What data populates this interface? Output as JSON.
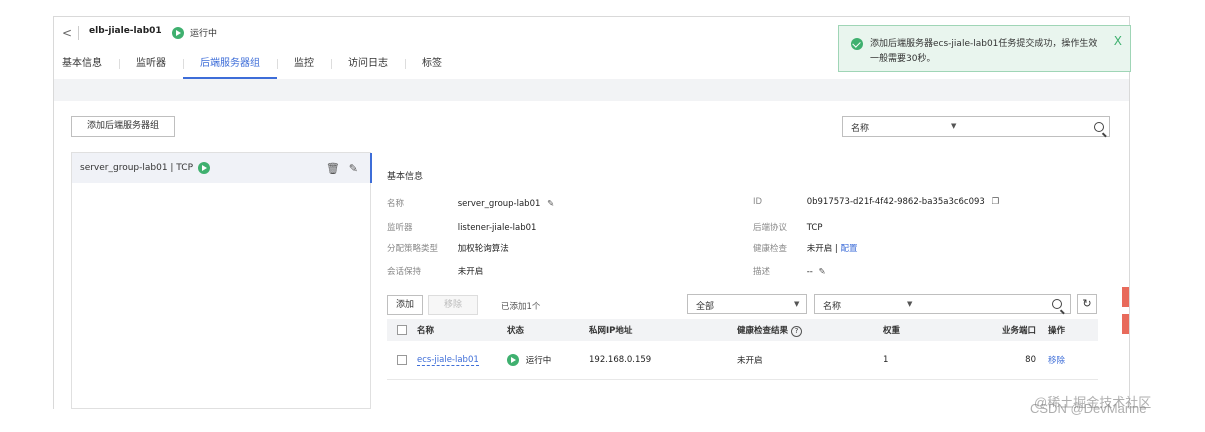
{
  "header": {
    "back_label": "<",
    "title": "elb-jiale-lab01",
    "status": "运行中"
  },
  "tabs": [
    "基本信息",
    "监听器",
    "后端服务器组",
    "监控",
    "访问日志",
    "标签"
  ],
  "active_tab": "后端服务器组",
  "toast": {
    "message": "添加后端服务器ecs-jiale-lab01任务提交成功，操作生效一般需要30秒。",
    "close_label": "X"
  },
  "toolbar": {
    "add_group_label": "添加后端服务器组",
    "filter_select": "名称"
  },
  "server_groups": [
    {
      "label": "server_group-lab01 | TCP"
    }
  ],
  "detail": {
    "section_title": "基本信息",
    "name_key": "名称",
    "name_val": "server_group-lab01",
    "listener_key": "监听器",
    "listener_val": "listener-jiale-lab01",
    "algo_key": "分配策略类型",
    "algo_val": "加权轮询算法",
    "session_key": "会话保持",
    "session_val": "未开启",
    "id_key": "ID",
    "id_val": "0b917573-d21f-4f42-9862-ba35a3c6c093",
    "protocol_key": "后端协议",
    "protocol_val": "TCP",
    "health_key": "健康检查",
    "health_val": "未开启 |",
    "health_link": "配置",
    "desc_key": "描述",
    "desc_val": "--"
  },
  "members_toolbar": {
    "add_label": "添加",
    "remove_label": "移除",
    "added_count": "已添加1个",
    "scope_select": "全部",
    "field_select": "名称"
  },
  "members_table": {
    "headers": [
      "名称",
      "状态",
      "私网IP地址",
      "健康检查结果",
      "权重",
      "业务端口",
      "操作"
    ],
    "rows": [
      {
        "name": "ecs-jiale-lab01",
        "status": "运行中",
        "ip": "192.168.0.159",
        "health": "未开启",
        "weight": "1",
        "port": "80",
        "action": "移除"
      }
    ]
  },
  "watermark": "CSDN @DevMarine",
  "watermark2": "@稀土掘金技术社区",
  "colors": {
    "accent": "#3d6dd8",
    "success": "#3fb06f",
    "bg": "#f2f3f5"
  }
}
